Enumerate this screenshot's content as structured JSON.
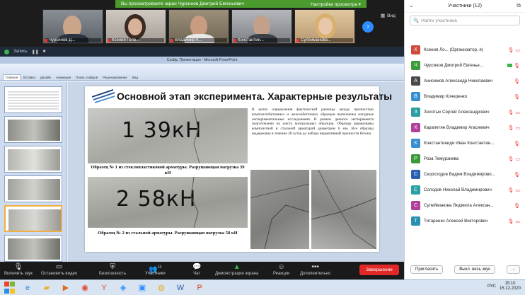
{
  "banner": {
    "text": "Вы просматриваете экран Чурсинов Дмитрий Евгеньевич",
    "options": "Настройки просмотра ▾"
  },
  "videos": [
    {
      "name": "Чурсинов Д..."
    },
    {
      "name": "Ксения Голе..."
    },
    {
      "name": "Владимир К..."
    },
    {
      "name": "Константин..."
    },
    {
      "name": "Сулейманова..."
    }
  ],
  "view_label": "Вид",
  "share_bar": {
    "recording": "Запись"
  },
  "ppt": {
    "title": "Слайд. Презентация - Microsoft PowerPoint",
    "tabs": [
      "Главная",
      "Вставка",
      "Дизайн",
      "Анимация",
      "Показ слайдов",
      "Рецензирование",
      "Вид"
    ],
    "thumbnail_numbers": [
      "10",
      "11",
      "12",
      "13",
      "14",
      "15"
    ]
  },
  "slide": {
    "title": "Основной этап эксперимента. Характерные результаты",
    "body": "В целях определения фактической разницы между прочностью композитобетонных и железобетонных образцов выполнены натурные экспериментальные исследования. В рамках данного эксперимента подготовлено по шесть контрольных образцов. Образцы армированы композитной и стальной арматурой диаметром 6 мм. Все образцы выдержаны в течение 28 суток до набора нормативной прочности бетона.",
    "photo1_text": "1 39кН",
    "photo2_text": "2 58кН",
    "caption1": "Образец № 1 из стеклопластиковой арматуры. Разрушающая нагрузка 39 кН",
    "caption2": "Образец № 2 из стальной арматуры. Разрушающая нагрузка 58 кН"
  },
  "toolbar": {
    "mute": "Включить звук",
    "video": "Остановить видео",
    "security": "Безопасность",
    "participants": "Участники",
    "participants_count": "12",
    "chat": "Чат",
    "share": "Демонстрация экрана",
    "reactions": "Реакции",
    "more": "Дополнительно",
    "end": "Завершение"
  },
  "panel": {
    "title": "Участники (12)",
    "search_placeholder": "Найти участника",
    "participants": [
      {
        "initial": "К",
        "name": "Ксения Ло... (Организатор, я)",
        "color": "#d04a3a"
      },
      {
        "initial": "Ч",
        "name": "Чурсинов Дмитрий Евгенье...",
        "color": "#3a9a3a"
      },
      {
        "initial": "А",
        "name": "Анисимов Александр Николаевич",
        "color": "#4a4a4a"
      },
      {
        "initial": "В",
        "name": "Владимир Кочеренко",
        "color": "#3a8fd0"
      },
      {
        "initial": "З",
        "name": "Золотых Сергей Александрович",
        "color": "#2aa0a0"
      },
      {
        "initial": "К",
        "name": "Карапетян Владимир Агасиевич",
        "color": "#b0409a"
      },
      {
        "initial": "К",
        "name": "Константиниди Иван Константин...",
        "color": "#3a8fd0"
      },
      {
        "initial": "Р",
        "name": "Роза Темурзиева",
        "color": "#3a9a3a"
      },
      {
        "initial": "С",
        "name": "Скорсходов Вадим Владимирово...",
        "color": "#2a5fb0"
      },
      {
        "initial": "С",
        "name": "Солодов Николай Владимирович",
        "color": "#2aa0a0"
      },
      {
        "initial": "С",
        "name": "Сулейманова Людмила Алексан...",
        "color": "#b0409a"
      },
      {
        "initial": "Т",
        "name": "Титаренко Алексей Викторович",
        "color": "#2a8fb0"
      }
    ],
    "invite": "Пригласить",
    "mute_all": "Выкл. весь звук",
    "more": "..."
  },
  "taskbar": {
    "lang": "РУС",
    "time": "15:10",
    "date": "15.12.2020"
  }
}
